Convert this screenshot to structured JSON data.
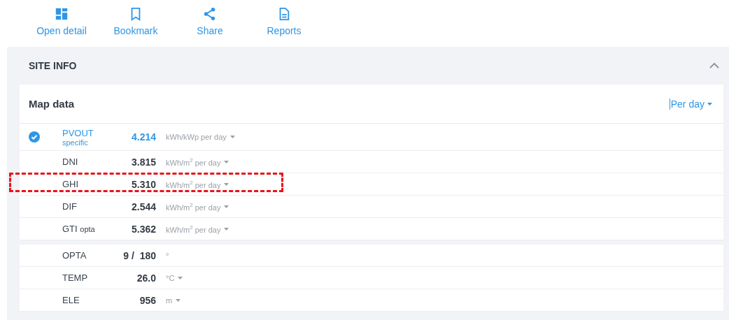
{
  "toolbar": [
    {
      "kind": "grid",
      "label": "Open detail"
    },
    {
      "kind": "bookmark",
      "label": "Bookmark"
    },
    {
      "kind": "share",
      "label": "Share"
    },
    {
      "kind": "report",
      "label": "Reports"
    }
  ],
  "section": {
    "title": "SITE INFO",
    "expanded": true,
    "card": {
      "title": "Map data",
      "period": "Per day",
      "groups": [
        [
          {
            "name": "PVOUT",
            "sub": "specific",
            "value": "4.214",
            "unit": "kWh/kWp per day",
            "menu": true,
            "checked": true,
            "highlighted": false
          },
          {
            "name": "DNI",
            "value": "3.815",
            "unit": "kWh/m$^{2}$ per day",
            "menu": true,
            "checked": false,
            "highlighted": false
          },
          {
            "name": "GHI",
            "value": "5.310",
            "unit": "kWh/m$^{2}$ per day",
            "menu": true,
            "checked": false,
            "highlighted": true
          },
          {
            "name": "DIF",
            "value": "2.544",
            "unit": "kWh/m$^{2}$ per day",
            "menu": true,
            "checked": false,
            "highlighted": false
          },
          {
            "name": "GTI",
            "sub": "opta",
            "value": "5.362",
            "unit": "kWh/m$^{2}$ per day",
            "menu": true,
            "checked": false,
            "highlighted": false
          }
        ],
        [
          {
            "name": "OPTA",
            "value": "9 /  180",
            "unit": "°",
            "menu": false
          },
          {
            "name": "TEMP",
            "value": "26.0",
            "unit": "°C",
            "menu": true
          },
          {
            "name": "ELE",
            "value": "956",
            "unit": "m",
            "menu": true
          }
        ]
      ]
    }
  }
}
